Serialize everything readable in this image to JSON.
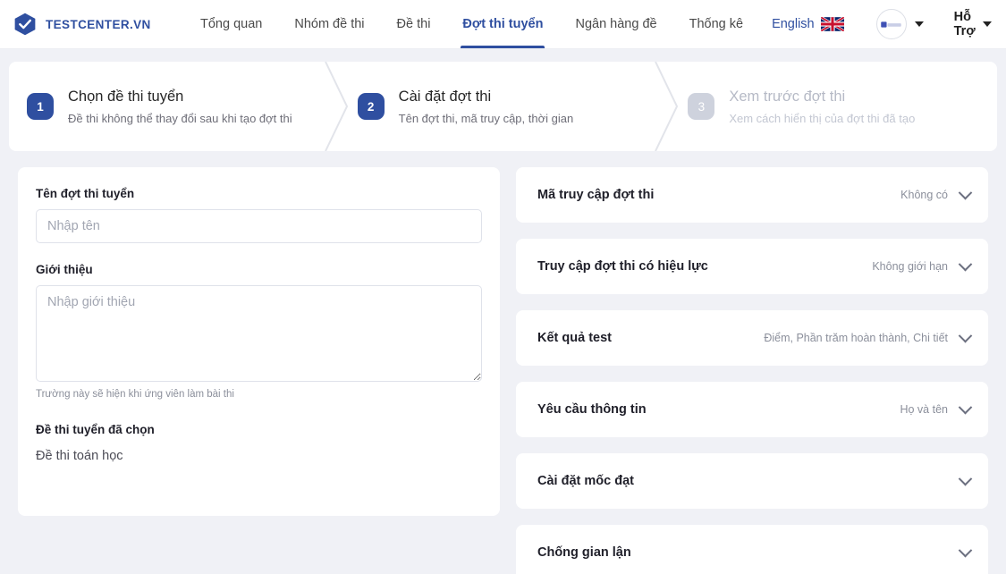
{
  "header": {
    "logo": {
      "icon": "shield-check-icon",
      "text": "TESTCENTER.VN"
    },
    "nav": [
      {
        "label": "Tổng quan",
        "active": false
      },
      {
        "label": "Nhóm đề thi",
        "active": false
      },
      {
        "label": "Đề thi",
        "active": false
      },
      {
        "label": "Đợt thi tuyển",
        "active": true
      },
      {
        "label": "Ngân hàng đề",
        "active": false
      },
      {
        "label": "Thống kê",
        "active": false
      }
    ],
    "language": {
      "label": "English",
      "icon": "uk-flag-icon"
    },
    "account": {
      "icon": "avatar-placeholder-icon",
      "caret": "caret-down-icon"
    },
    "support": {
      "label": "Hỗ Trợ",
      "caret": "caret-down-icon"
    }
  },
  "stepper": [
    {
      "number": "1",
      "title": "Chọn đề thi tuyển",
      "subtitle": "Đề thi không thể thay đổi sau khi tạo đợt thi",
      "state": "done"
    },
    {
      "number": "2",
      "title": "Cài đặt đợt thi",
      "subtitle": "Tên đợt thi, mã truy cập, thời gian",
      "state": "current"
    },
    {
      "number": "3",
      "title": "Xem trước đợt thi",
      "subtitle": "Xem cách hiển thị của đợt thi đã tạo",
      "state": "upcoming"
    }
  ],
  "form": {
    "name_label": "Tên đợt thi tuyển",
    "name_value": "",
    "name_placeholder": "Nhập tên",
    "intro_label": "Giới thiệu",
    "intro_value": "",
    "intro_placeholder": "Nhập giới thiệu",
    "intro_helper": "Trường này sẽ hiện khi ứng viên làm bài thi",
    "selected_exam_label": "Đề thi tuyển đã chọn",
    "selected_exam_value": "Đề thi toán học"
  },
  "settings": [
    {
      "label": "Mã truy cập đợt thi",
      "value": "Không có",
      "chevron": "chevron-down-icon"
    },
    {
      "label": "Truy cập đợt thi có hiệu lực",
      "value": "Không giới hạn",
      "chevron": "chevron-down-icon"
    },
    {
      "label": "Kết quả test",
      "value": "Điểm, Phần trăm hoàn thành, Chi tiết",
      "chevron": "chevron-down-icon"
    },
    {
      "label": "Yêu cầu thông tin",
      "value": "Họ và tên",
      "chevron": "chevron-down-icon"
    },
    {
      "label": "Cài đặt mốc đạt",
      "value": "",
      "chevron": "chevron-down-icon"
    },
    {
      "label": "Chống gian lận",
      "value": "",
      "chevron": "chevron-down-icon"
    }
  ],
  "colors": {
    "brand": "#2f4fa0",
    "page_bg": "#f0f1f6",
    "card_bg": "#ffffff",
    "muted_text": "#8b8f9b",
    "step_inactive": "#ced2dd"
  }
}
